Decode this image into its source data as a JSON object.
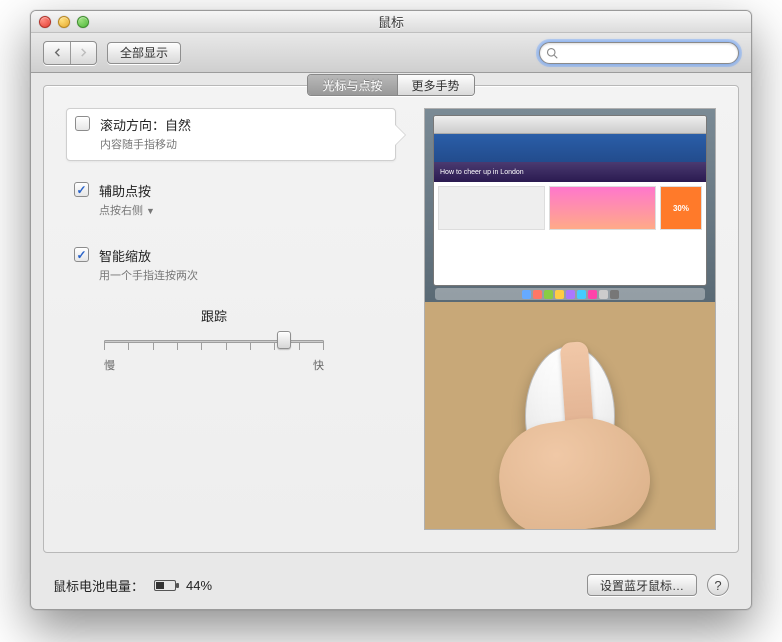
{
  "window": {
    "title": "鼠标"
  },
  "toolbar": {
    "show_all_label": "全部显示",
    "search_placeholder": ""
  },
  "tabs": {
    "point_click": "光标与点按",
    "more_gestures": "更多手势",
    "active": "point_click"
  },
  "options": {
    "scroll": {
      "title": "滚动方向：自然",
      "subtitle": "内容随手指移动",
      "checked": false,
      "selected": true
    },
    "secondary": {
      "title": "辅助点按",
      "subtitle": "点按右侧",
      "checked": true,
      "has_dropdown": true
    },
    "smartzoom": {
      "title": "智能缩放",
      "subtitle": "用一个手指连按两次",
      "checked": true
    }
  },
  "tracking": {
    "title": "跟踪",
    "slow": "慢",
    "fast": "快",
    "value_percent": 82
  },
  "preview": {
    "banner_text": "How to cheer up in London",
    "sale_text": "30%"
  },
  "footer": {
    "battery_label": "鼠标电池电量：",
    "battery_percent": 44,
    "percent_text": "44%",
    "setup_button": "设置蓝牙鼠标…"
  }
}
